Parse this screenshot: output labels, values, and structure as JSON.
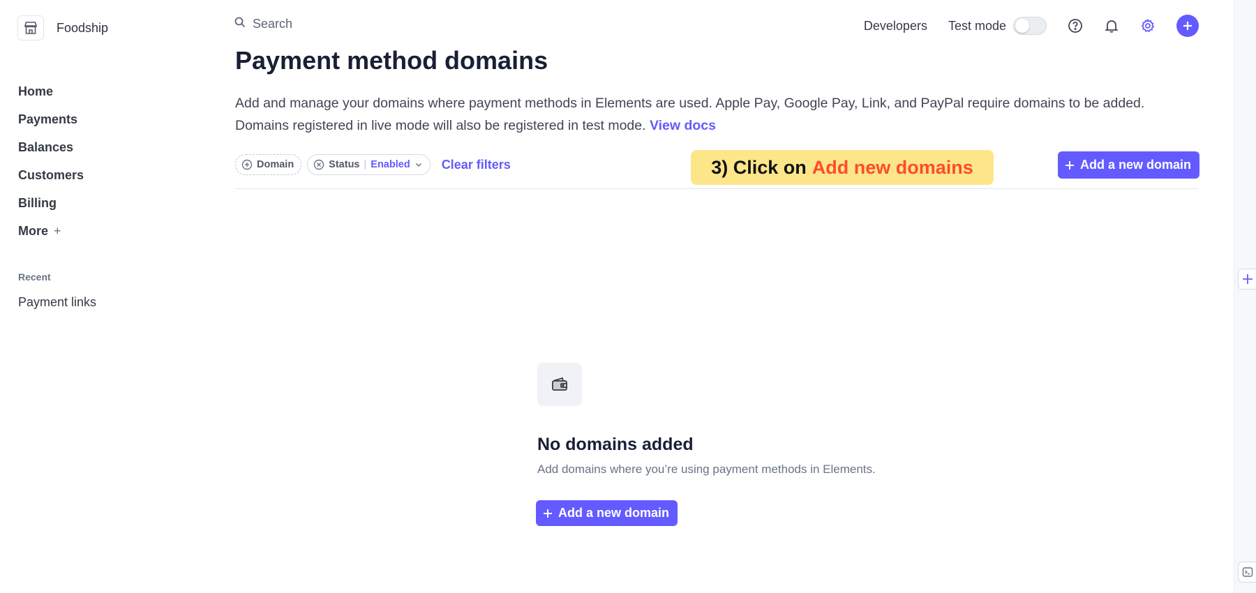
{
  "brand": {
    "name": "Foodship"
  },
  "sidebar": {
    "items": [
      {
        "label": "Home"
      },
      {
        "label": "Payments"
      },
      {
        "label": "Balances"
      },
      {
        "label": "Customers"
      },
      {
        "label": "Billing"
      },
      {
        "label": "More",
        "suffix": "+"
      }
    ],
    "recent_title": "Recent",
    "recent_items": [
      {
        "label": "Payment links"
      }
    ]
  },
  "topbar": {
    "search_placeholder": "Search",
    "developers_label": "Developers",
    "test_mode_label": "Test mode",
    "test_mode_on": false
  },
  "main": {
    "title": "Payment method domains",
    "description": "Add and manage your domains where payment methods in Elements are used. Apple Pay, Google Pay, Link, and PayPal require domains to be added. Domains registered in live mode will also be registered in test mode.",
    "view_docs_label": "View docs",
    "filters": {
      "domain_label": "Domain",
      "status_label": "Status",
      "status_value": "Enabled",
      "clear_label": "Clear filters"
    },
    "add_button_label": "Add a new domain"
  },
  "callout": {
    "prefix": "3) Click on",
    "highlight": "Add new domains"
  },
  "empty_state": {
    "title": "No domains added",
    "subtitle": "Add domains where you’re using payment methods in Elements.",
    "button_label": "Add a new domain"
  },
  "colors": {
    "accent": "#635bff",
    "callout_bg": "#fde68a",
    "callout_highlight": "#ff4b2b"
  }
}
